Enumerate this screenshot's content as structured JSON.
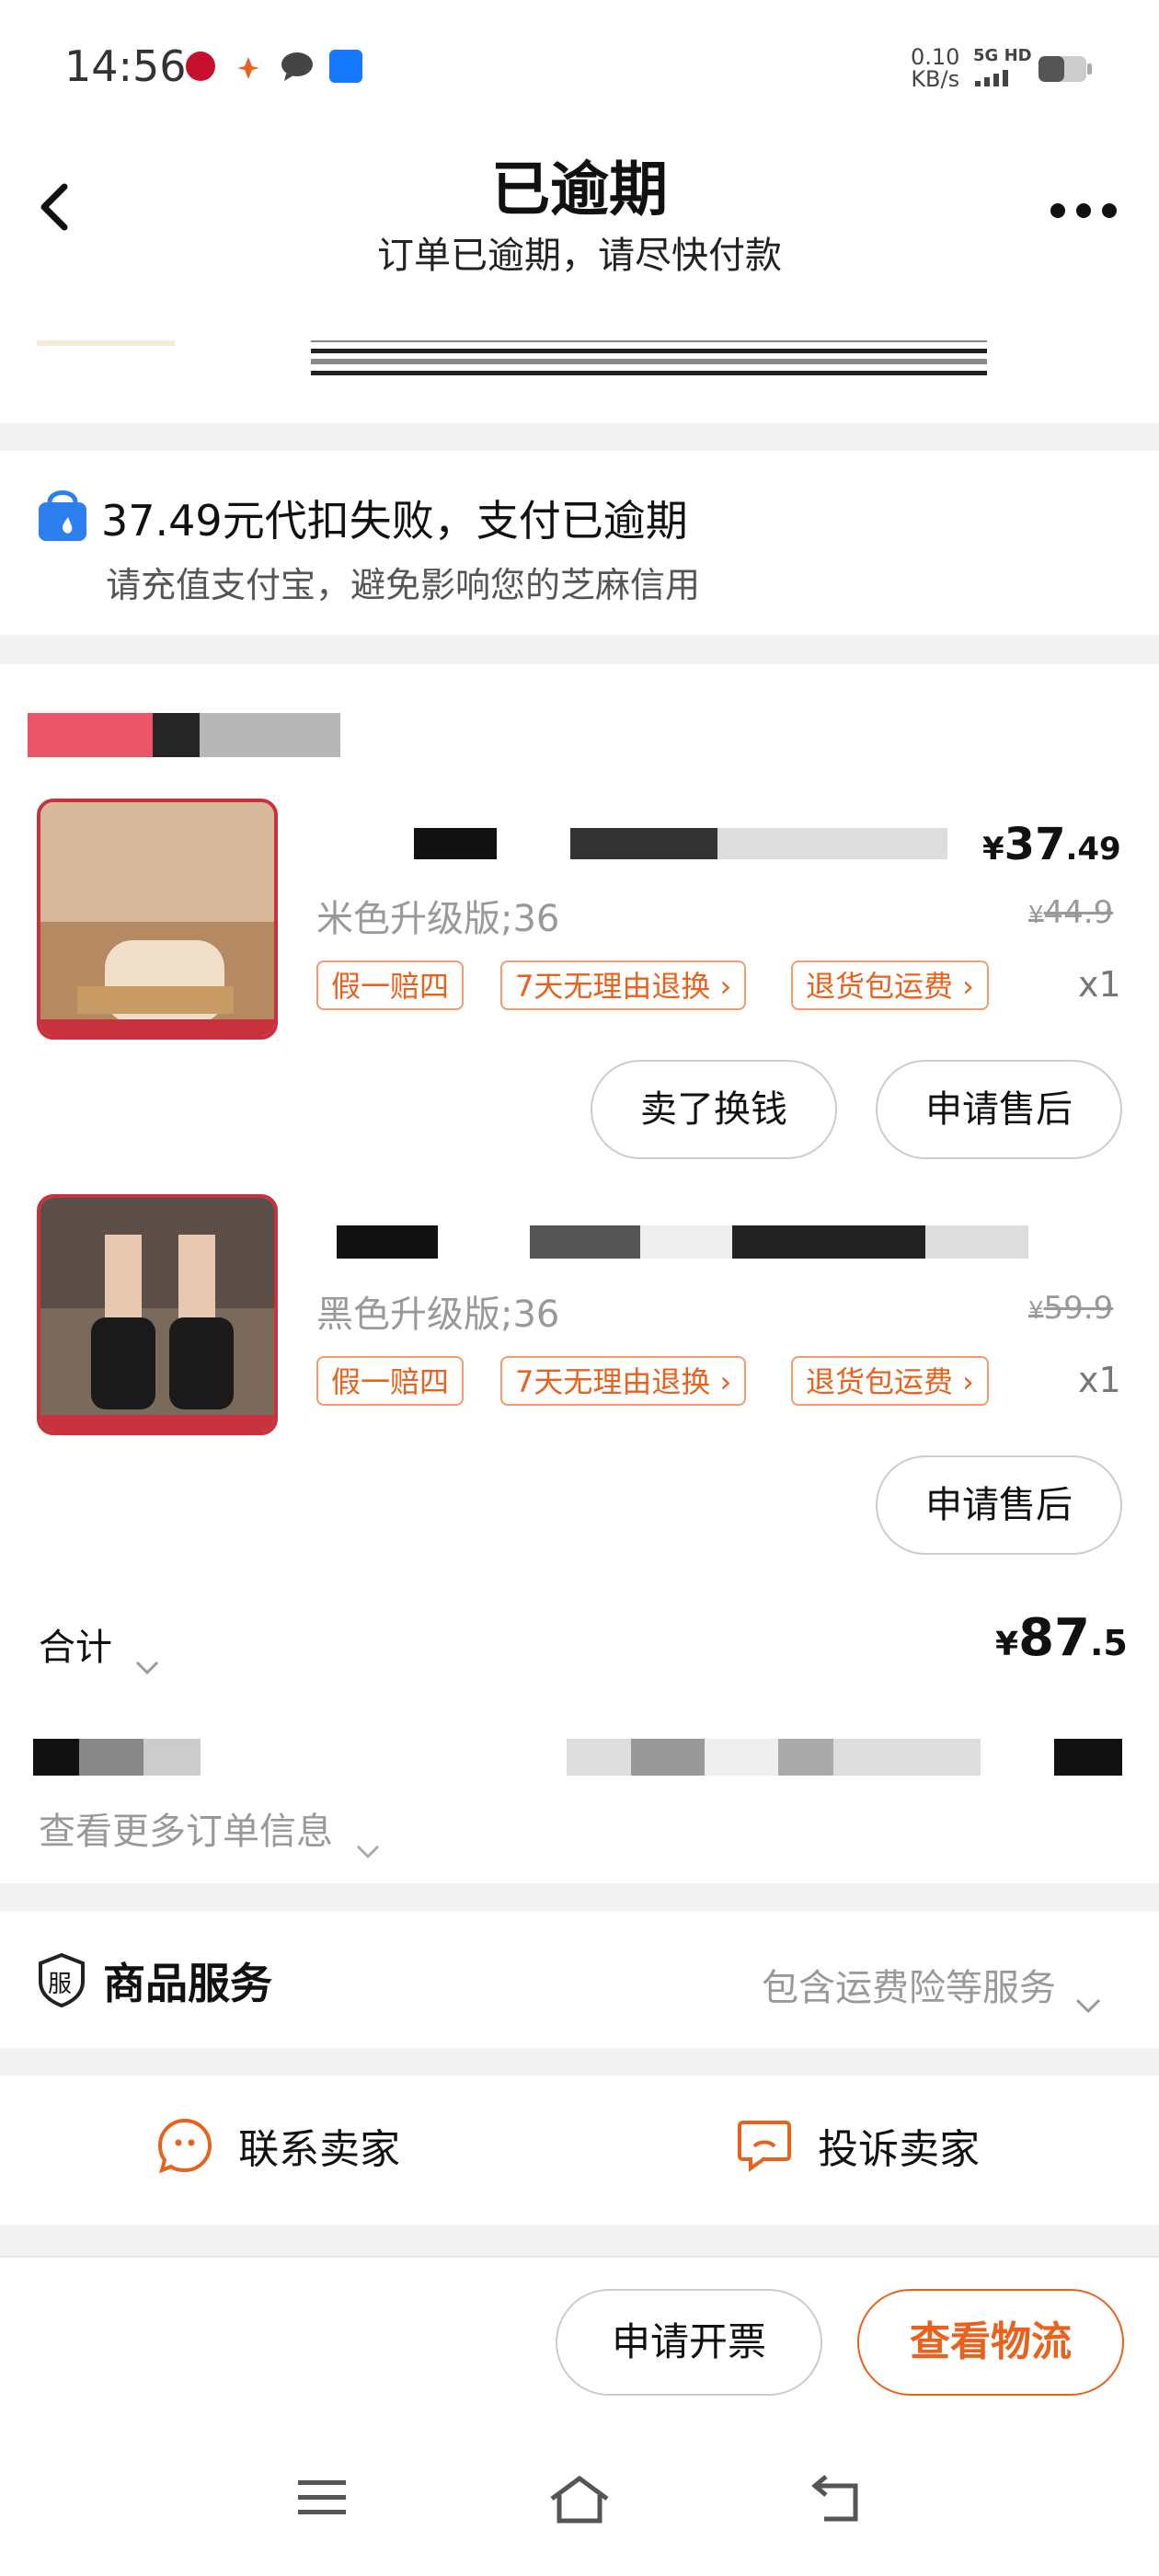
{
  "status_bar": {
    "time": "14:56",
    "net_speed_value": "0.10",
    "net_speed_unit": "KB/s",
    "signal": "5G HD"
  },
  "header": {
    "title": "已逾期",
    "subtitle": "订单已逾期，请尽快付款"
  },
  "alert": {
    "title": "37.49元代扣失败，支付已逾期",
    "subtitle": "请充值支付宝，避免影响您的芝麻信用"
  },
  "items": [
    {
      "spec": "米色升级版;36",
      "price_int": "37",
      "price_dec": ".49",
      "orig_price": "44.9",
      "tags": [
        "假一赔四",
        "7天无理由退换 ›",
        "退货包运费 ›"
      ],
      "qty": "x1",
      "buttons": [
        "卖了换钱",
        "申请售后"
      ]
    },
    {
      "spec": "黑色升级版;36",
      "orig_price": "59.9",
      "tags": [
        "假一赔四",
        "7天无理由退换 ›",
        "退货包运费 ›"
      ],
      "qty": "x1",
      "buttons": [
        "申请售后"
      ]
    }
  ],
  "total": {
    "label": "合计",
    "currency": "¥",
    "amount_int": "87",
    "amount_dec": ".5"
  },
  "more_info": "查看更多订单信息",
  "service": {
    "label": "商品服务",
    "icon_text": "服",
    "detail": "包含运费险等服务"
  },
  "contact": {
    "contact_seller": "联系卖家",
    "complain_seller": "投诉卖家"
  },
  "bottom_bar": {
    "invoice": "申请开票",
    "logistics": "查看物流"
  },
  "colors": {
    "accent": "#e8621d",
    "alert_icon": "#2d7ff0",
    "border": "#cccccc"
  }
}
